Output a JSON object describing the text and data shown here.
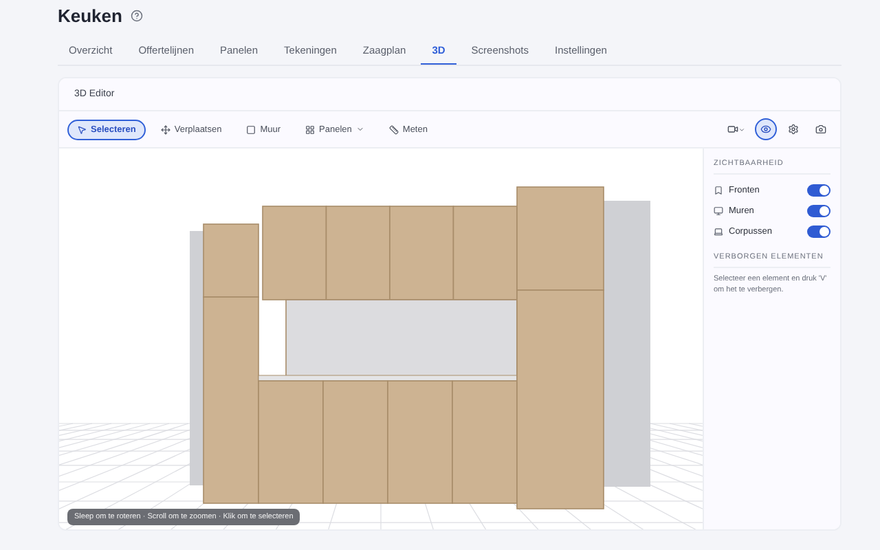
{
  "page": {
    "title": "Keuken"
  },
  "tabs": [
    {
      "label": "Overzicht",
      "selected": false
    },
    {
      "label": "Offertelijnen",
      "selected": false
    },
    {
      "label": "Panelen",
      "selected": false
    },
    {
      "label": "Tekeningen",
      "selected": false
    },
    {
      "label": "Zaagplan",
      "selected": false
    },
    {
      "label": "3D",
      "selected": true
    },
    {
      "label": "Screenshots",
      "selected": false
    },
    {
      "label": "Instellingen",
      "selected": false
    }
  ],
  "editor": {
    "title": "3D Editor",
    "tools": [
      {
        "kind": "pointer",
        "label": "Selecteren",
        "selected": true
      },
      {
        "kind": "move",
        "label": "Verplaatsen",
        "selected": false
      },
      {
        "kind": "wall",
        "label": "Muur",
        "selected": false
      },
      {
        "kind": "panels",
        "label": "Panelen",
        "selected": false,
        "dropdown": true
      },
      {
        "kind": "measure",
        "label": "Meten",
        "selected": false
      }
    ],
    "view_buttons": [
      {
        "kind": "camera-menu",
        "selected": false
      },
      {
        "kind": "eye",
        "selected": true
      },
      {
        "kind": "settings",
        "selected": false
      },
      {
        "kind": "screenshot",
        "selected": false
      }
    ],
    "hint": "Sleep om te roteren · Scroll om te zoomen · Klik om te selecteren"
  },
  "sidebar": {
    "visibility_heading": "ZICHTBAARHEID",
    "layers": [
      {
        "kind": "fronts",
        "label": "Fronten",
        "on": true
      },
      {
        "kind": "walls",
        "label": "Muren",
        "on": true
      },
      {
        "kind": "carcass",
        "label": "Corpussen",
        "on": true
      }
    ],
    "hidden_heading": "VERBORGEN ELEMENTEN",
    "hidden_text": "Selecteer een element en druk 'V' om het te verbergen."
  }
}
